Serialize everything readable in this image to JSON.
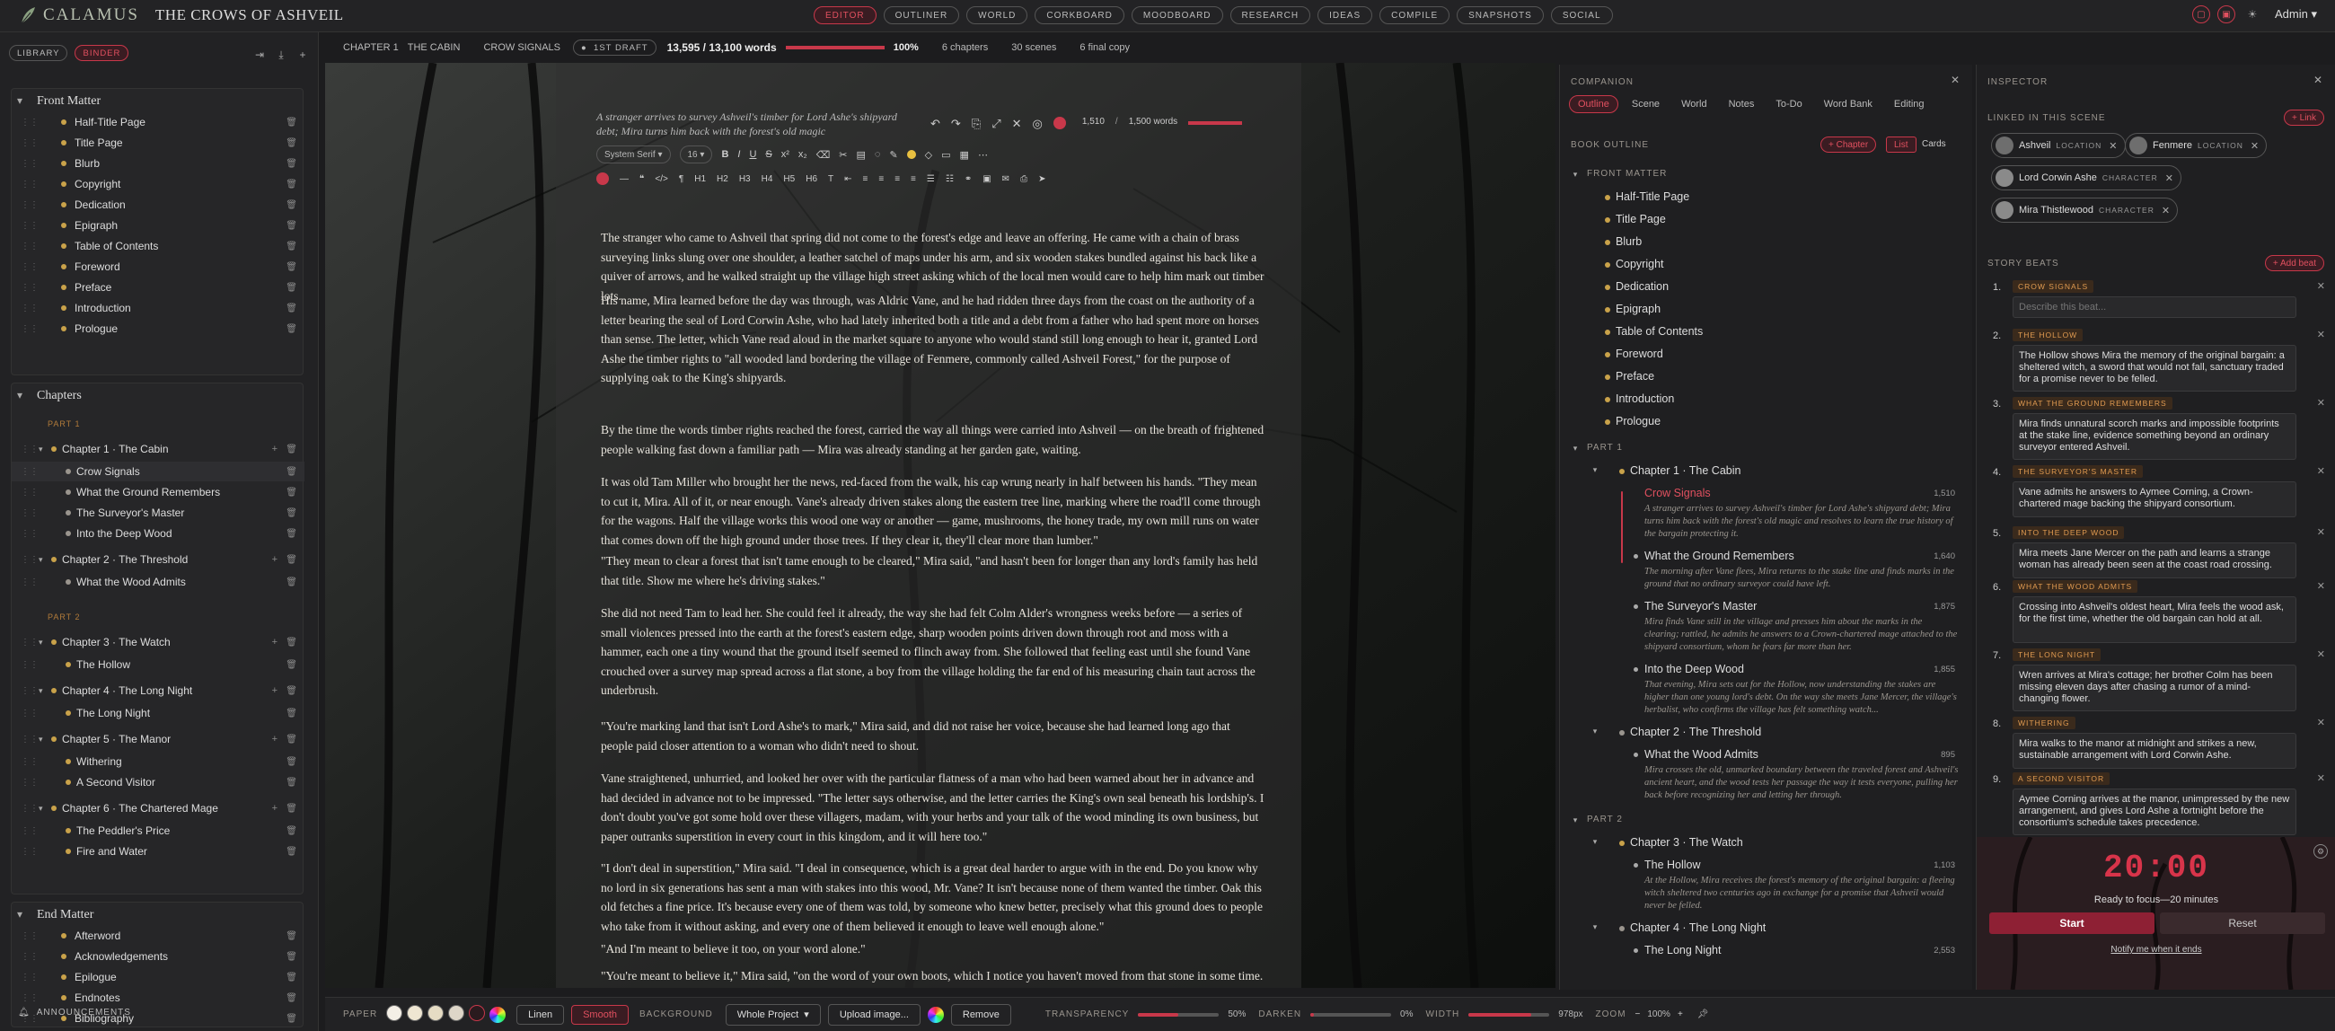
{
  "app": {
    "name": "CALAMUS",
    "project": "THE CROWS OF ASHVEIL",
    "user": "Admin"
  },
  "modes": [
    "EDITOR",
    "OUTLINER",
    "WORLD",
    "CORKBOARD",
    "MOODBOARD",
    "RESEARCH",
    "IDEAS",
    "COMPILE",
    "SNAPSHOTS",
    "SOCIAL"
  ],
  "sidebar": {
    "tabs": [
      "LIBRARY",
      "BINDER"
    ],
    "front_matter": {
      "title": "Front Matter",
      "items": [
        "Half-Title Page",
        "Title Page",
        "Blurb",
        "Copyright",
        "Dedication",
        "Epigraph",
        "Table of Contents",
        "Foreword",
        "Preface",
        "Introduction",
        "Prologue"
      ]
    },
    "chapters": {
      "title": "Chapters",
      "part1": "PART 1",
      "part2": "PART 2",
      "ch1": "Chapter 1 · The Cabin",
      "ch1_scenes": [
        "Crow Signals",
        "What the Ground Remembers",
        "The Surveyor's Master",
        "Into the Deep Wood"
      ],
      "ch2": "Chapter 2 · The Threshold",
      "ch2_scenes": [
        "What the Wood Admits"
      ],
      "ch3": "Chapter 3 · The Watch",
      "ch3_scenes": [
        "The Hollow"
      ],
      "ch4": "Chapter 4 · The Long Night",
      "ch4_scenes": [
        "The Long Night"
      ],
      "ch5": "Chapter 5 · The Manor",
      "ch5_scenes": [
        "Withering",
        "A Second Visitor"
      ],
      "ch6": "Chapter 6 · The Chartered Mage",
      "ch6_scenes": [
        "The Peddler's Price",
        "Fire and Water"
      ]
    },
    "end_matter": {
      "title": "End Matter",
      "items": [
        "Afterword",
        "Acknowledgements",
        "Epilogue",
        "Endnotes",
        "Bibliography"
      ]
    },
    "announcements": "ANNOUNCEMENTS"
  },
  "editor_head": {
    "chapter": "CHAPTER 1",
    "chapter_name": "THE CABIN",
    "scene": "CROW SIGNALS",
    "draft": "1ST DRAFT",
    "words": "13,595 / 13,100 words",
    "percent": "100%",
    "chapters": "6 chapters",
    "scenes": "30 scenes",
    "final": "6 final copy",
    "progress": 1.0
  },
  "editor": {
    "synopsis": "A stranger arrives to survey Ashveil's timber for Lord Ashe's shipyard debt; Mira turns him back with the forest's old magic",
    "font": "System Serif",
    "size": "16",
    "wordcount": "1,510",
    "goal": "1,500 words",
    "paragraphs": [
      "The stranger who came to Ashveil that spring did not come to the forest's edge and leave an offering. He came with a chain of brass surveying links slung over one shoulder, a leather satchel of maps under his arm, and six wooden stakes bundled against his back like a quiver of arrows, and he walked straight up the village high street asking which of the local men would care to help him mark out timber lots.",
      "His name, Mira learned before the day was through, was Aldric Vane, and he had ridden three days from the coast on the authority of a letter bearing the seal of Lord Corwin Ashe, who had lately inherited both a title and a debt from a father who had spent more on horses than sense. The letter, which Vane read aloud in the market square to anyone who would stand still long enough to hear it, granted Lord Ashe the timber rights to \"all wooded land bordering the village of Fenmere, commonly called Ashveil Forest,\" for the purpose of supplying oak to the King's shipyards.",
      "By the time the words timber rights reached the forest, carried the way all things were carried into Ashveil — on the breath of frightened people walking fast down a familiar path — Mira was already standing at her garden gate, waiting.",
      "It was old Tam Miller who brought her the news, red-faced from the walk, his cap wrung nearly in half between his hands. \"They mean to cut it, Mira. All of it, or near enough. Vane's already driven stakes along the eastern tree line, marking where the road'll come through for the wagons. Half the village works this wood one way or another — game, mushrooms, the honey trade, my own mill runs on water that comes down off the high ground under those trees. If they clear it, they'll clear more than lumber.\"",
      "\"They mean to clear a forest that isn't tame enough to be cleared,\" Mira said, \"and hasn't been for longer than any lord's family has held that title. Show me where he's driving stakes.\"",
      "She did not need Tam to lead her. She could feel it already, the way she had felt Colm Alder's wrongness weeks before — a series of small violences pressed into the earth at the forest's eastern edge, sharp wooden points driven down through root and moss with a hammer, each one a tiny wound that the ground itself seemed to flinch away from. She followed that feeling east until she found Vane crouched over a survey map spread across a flat stone, a boy from the village holding the far end of his measuring chain taut across the underbrush.",
      "\"You're marking land that isn't Lord Ashe's to mark,\" Mira said, and did not raise her voice, because she had learned long ago that people paid closer attention to a woman who didn't need to shout.",
      "Vane straightened, unhurried, and looked her over with the particular flatness of a man who had been warned about her in advance and had decided in advance not to be impressed. \"The letter says otherwise, and the letter carries the King's own seal beneath his lordship's. I don't doubt you've got some hold over these villagers, madam, with your herbs and your talk of the wood minding its own business, but paper outranks superstition in every court in this kingdom, and it will here too.\"",
      "\"I don't deal in superstition,\" Mira said. \"I deal in consequence, which is a great deal harder to argue with in the end. Do you know why no lord in six generations has sent a man with stakes into this wood, Mr. Vane? It isn't because none of them wanted the timber. Oak this old fetches a fine price. It's because every one of them was told, by someone who knew better, precisely what this ground does to people who take from it without asking, and every one of them believed it enough to leave well enough alone.\"",
      "\"And I'm meant to believe it too, on your word alone.\"",
      "\"You're meant to believe it,\" Mira said, \"on the word of your own boots, which I notice you haven't moved from that stone in some time."
    ]
  },
  "bottombar": {
    "paper": "PAPER",
    "linen": "Linen",
    "smooth": "Smooth",
    "background": "BACKGROUND",
    "bg_scope": "Whole Project",
    "upload": "Upload image...",
    "remove": "Remove",
    "transparency": "TRANSPARENCY",
    "transparency_val": "50%",
    "transparency_level": 0.5,
    "darken": "DARKEN",
    "darken_val": "0%",
    "width": "WIDTH",
    "width_val": "978px",
    "zoom": "ZOOM",
    "zoom_val": "100%",
    "swatches": [
      "#f4efe6",
      "#efe6d2",
      "#e6dcc4",
      "#ded6c8",
      "#2a1a1e"
    ]
  },
  "companion": {
    "title": "COMPANION",
    "tabs": [
      "Outline",
      "Scene",
      "World",
      "Notes",
      "To-Do",
      "Word Bank",
      "Editing"
    ],
    "book_outline": "BOOK OUTLINE",
    "add_chapter": "+ Chapter",
    "view_list": "List",
    "view_cards": "Cards",
    "front_matter": "FRONT MATTER",
    "front_items": [
      "Half-Title Page",
      "Title Page",
      "Blurb",
      "Copyright",
      "Dedication",
      "Epigraph",
      "Table of Contents",
      "Foreword",
      "Preface",
      "Introduction",
      "Prologue"
    ],
    "part1": "PART 1",
    "ch1": "Chapter 1 · The Cabin",
    "scenes1": [
      {
        "title": "Crow Signals",
        "wc": "1,510",
        "syn": "A stranger arrives to survey Ashveil's timber for Lord Ashe's shipyard debt; Mira turns him back with the forest's old magic and resolves to learn the true history of the bargain protecting it."
      },
      {
        "title": "What the Ground Remembers",
        "wc": "1,640",
        "syn": "The morning after Vane flees, Mira returns to the stake line and finds marks in the ground that no ordinary surveyor could have left."
      },
      {
        "title": "The Surveyor's Master",
        "wc": "1,875",
        "syn": "Mira finds Vane still in the village and presses him about the marks in the clearing; rattled, he admits he answers to a Crown-chartered mage attached to the shipyard consortium, whom he fears far more than her."
      },
      {
        "title": "Into the Deep Wood",
        "wc": "1,855",
        "syn": "That evening, Mira sets out for the Hollow, now understanding the stakes are higher than one young lord's debt. On the way she meets Jane Mercer, the village's herbalist, who confirms the village has felt something watch..."
      }
    ],
    "ch2": "Chapter 2 · The Threshold",
    "scenes2": [
      {
        "title": "What the Wood Admits",
        "wc": "895",
        "syn": "Mira crosses the old, unmarked boundary between the traveled forest and Ashveil's ancient heart, and the wood tests her passage the way it tests everyone, pulling her back before recognizing her and letting her through."
      }
    ],
    "part2": "PART 2",
    "ch3": "Chapter 3 · The Watch",
    "scenes3": [
      {
        "title": "The Hollow",
        "wc": "1,103",
        "syn": "At the Hollow, Mira receives the forest's memory of the original bargain: a fleeing witch sheltered two centuries ago in exchange for a promise that Ashveil would never be felled."
      }
    ],
    "ch4": "Chapter 4 · The Long Night",
    "scenes4": [
      {
        "title": "The Long Night",
        "wc": "2,553"
      }
    ]
  },
  "inspector": {
    "title": "INSPECTOR",
    "linked": "LINKED IN THIS SCENE",
    "add_link": "+ Link",
    "story_beats": "STORY BEATS",
    "add_beat": "+ Add beat",
    "links": [
      {
        "name": "Ashveil",
        "kind": "LOCATION"
      },
      {
        "name": "Fenmere",
        "kind": "LOCATION"
      },
      {
        "name": "Lord Corwin Ashe",
        "kind": "CHARACTER"
      },
      {
        "name": "Mira Thistlewood",
        "kind": "CHARACTER"
      }
    ],
    "beats": [
      {
        "n": "1.",
        "tag": "CROW SIGNALS",
        "text": "",
        "placeholder": "Describe this beat..."
      },
      {
        "n": "2.",
        "tag": "THE HOLLOW",
        "text": "The Hollow shows Mira the memory of the original bargain: a sheltered witch, a sword that would not fall, sanctuary traded for a promise never to be felled."
      },
      {
        "n": "3.",
        "tag": "WHAT THE GROUND REMEMBERS",
        "text": "Mira finds unnatural scorch marks and impossible footprints at the stake line, evidence something beyond an ordinary surveyor entered Ashveil."
      },
      {
        "n": "4.",
        "tag": "THE SURVEYOR'S MASTER",
        "text": "Vane admits he answers to Aymee Corning, a Crown-chartered mage backing the shipyard consortium."
      },
      {
        "n": "5.",
        "tag": "INTO THE DEEP WOOD",
        "text": "Mira meets Jane Mercer on the path and learns a strange woman has already been seen at the coast road crossing."
      },
      {
        "n": "6.",
        "tag": "WHAT THE WOOD ADMITS",
        "text": "Crossing into Ashveil's oldest heart, Mira feels the wood ask, for the first time, whether the old bargain can hold at all."
      },
      {
        "n": "7.",
        "tag": "THE LONG NIGHT",
        "text": "Wren arrives at Mira's cottage; her brother Colm has been missing eleven days after chasing a rumor of a mind-changing flower."
      },
      {
        "n": "8.",
        "tag": "WITHERING",
        "text": "Mira walks to the manor at midnight and strikes a new, sustainable arrangement with Lord Corwin Ashe."
      },
      {
        "n": "9.",
        "tag": "A SECOND VISITOR",
        "text": "Aymee Corning arrives at the manor, unimpressed by the new arrangement, and gives Lord Ashe a fortnight before the consortium's schedule takes precedence."
      }
    ]
  },
  "timer": {
    "time": "20:00",
    "caption": "Ready to focus—20 minutes",
    "start": "Start",
    "reset": "Reset",
    "notify": "Notify me when it ends"
  },
  "colors": {
    "accent": "#c8384a",
    "gold": "#c9a24a",
    "tag": "#e09a50"
  }
}
